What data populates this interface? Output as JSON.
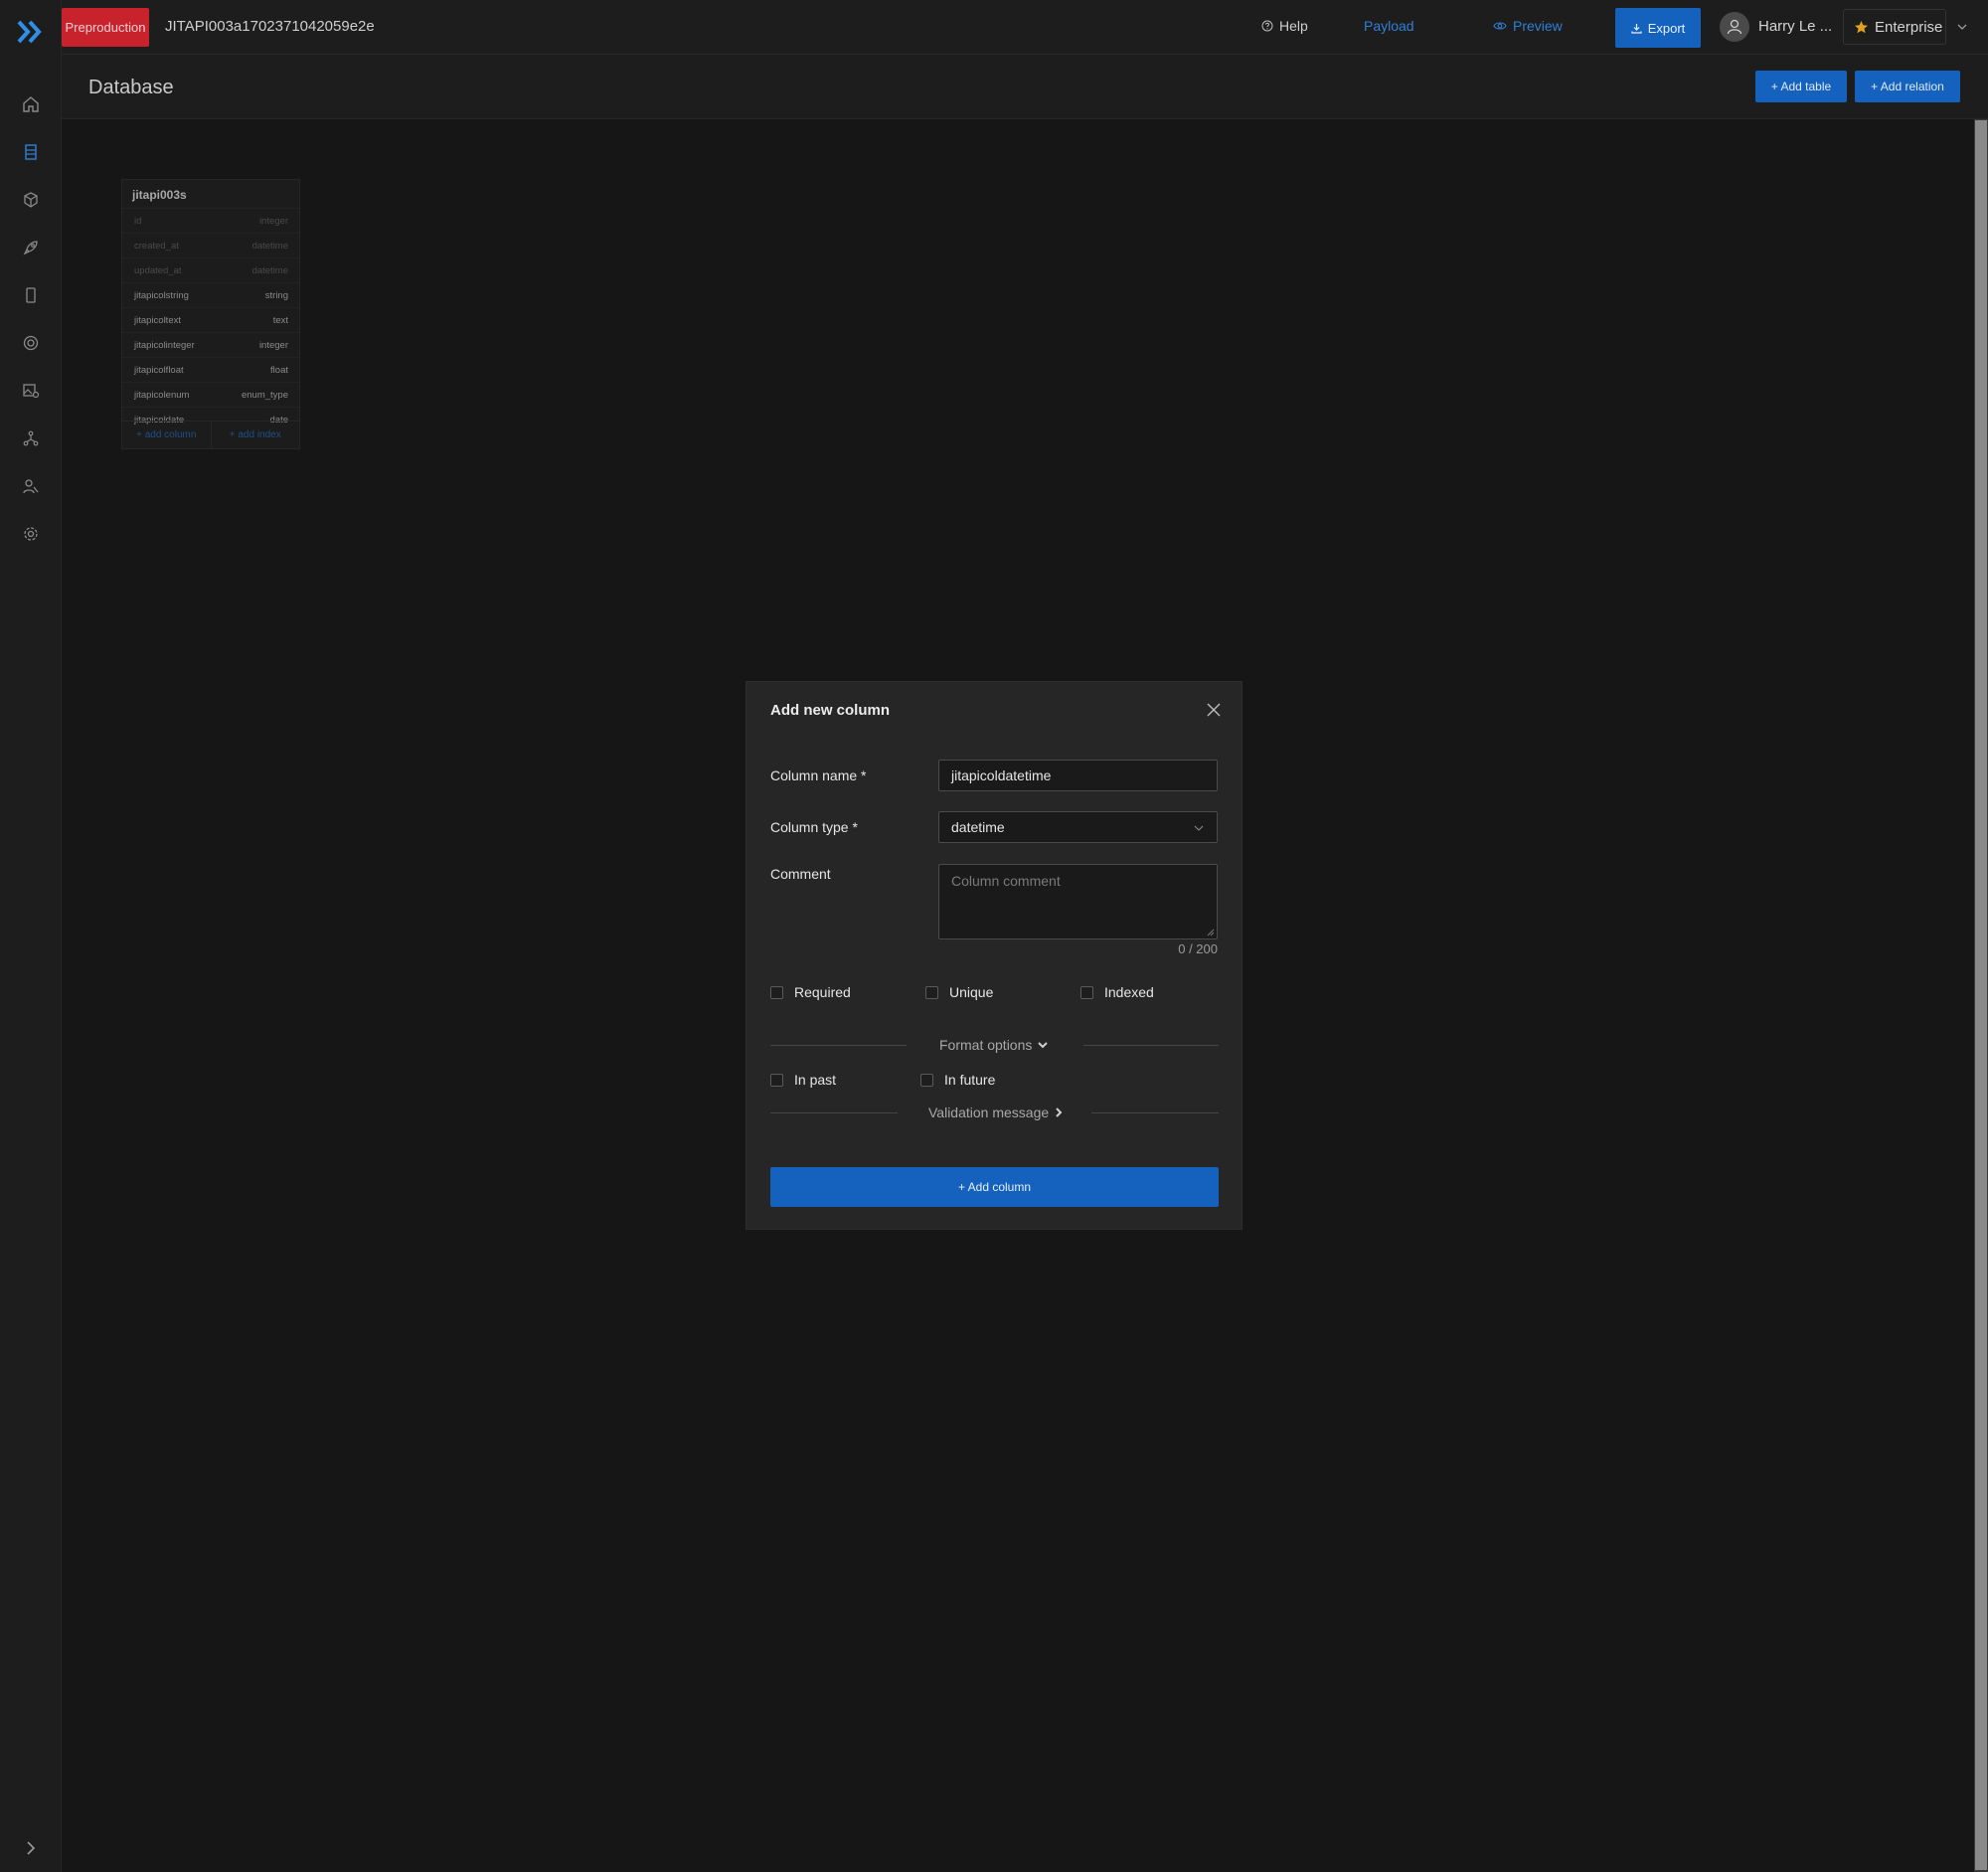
{
  "app": {
    "environment_badge": "Preproduction",
    "project_id": "JITAPI003a1702371042059e2e",
    "colors": {
      "accent": "#1462bd",
      "danger": "#c8232c",
      "link": "#2f7fd6"
    }
  },
  "topbar": {
    "help": "Help",
    "payload": "Payload",
    "preview": "Preview",
    "export": "Export",
    "user_name": "Harry Le ...",
    "plan": "Enterprise"
  },
  "sidebar": {
    "items": [
      {
        "icon": "home-icon"
      },
      {
        "icon": "database-icon"
      },
      {
        "icon": "cube-icon"
      },
      {
        "icon": "rocket-icon"
      },
      {
        "icon": "mobile-icon"
      },
      {
        "icon": "life-ring-icon"
      },
      {
        "icon": "image-settings-icon"
      },
      {
        "icon": "graph-icon"
      },
      {
        "icon": "users-icon"
      },
      {
        "icon": "gear-icon"
      }
    ]
  },
  "page": {
    "title": "Database",
    "add_table": "+ Add table",
    "add_relation": "+ Add relation"
  },
  "table_card": {
    "name": "jitapi003s",
    "columns": [
      {
        "name": "id",
        "type": "integer"
      },
      {
        "name": "created_at",
        "type": "datetime"
      },
      {
        "name": "updated_at",
        "type": "datetime"
      },
      {
        "name": "jitapicolstring",
        "type": "string"
      },
      {
        "name": "jitapicoltext",
        "type": "text"
      },
      {
        "name": "jitapicolinteger",
        "type": "integer"
      },
      {
        "name": "jitapicolfloat",
        "type": "float"
      },
      {
        "name": "jitapicolenum",
        "type": "enum_type"
      },
      {
        "name": "jitapicoldate",
        "type": "date"
      }
    ],
    "add_column": "+ add column",
    "add_index": "+ add index"
  },
  "modal": {
    "title": "Add new column",
    "column_name_label": "Column name *",
    "column_name_value": "jitapicoldatetime",
    "column_type_label": "Column type *",
    "column_type_value": "datetime",
    "comment_label": "Comment",
    "comment_placeholder": "Column comment",
    "comment_counter": "0 / 200",
    "required": "Required",
    "unique": "Unique",
    "indexed": "Indexed",
    "format_options": "Format options",
    "in_past": "In past",
    "in_future": "In future",
    "validation_message": "Validation message",
    "submit": "+ Add column"
  }
}
